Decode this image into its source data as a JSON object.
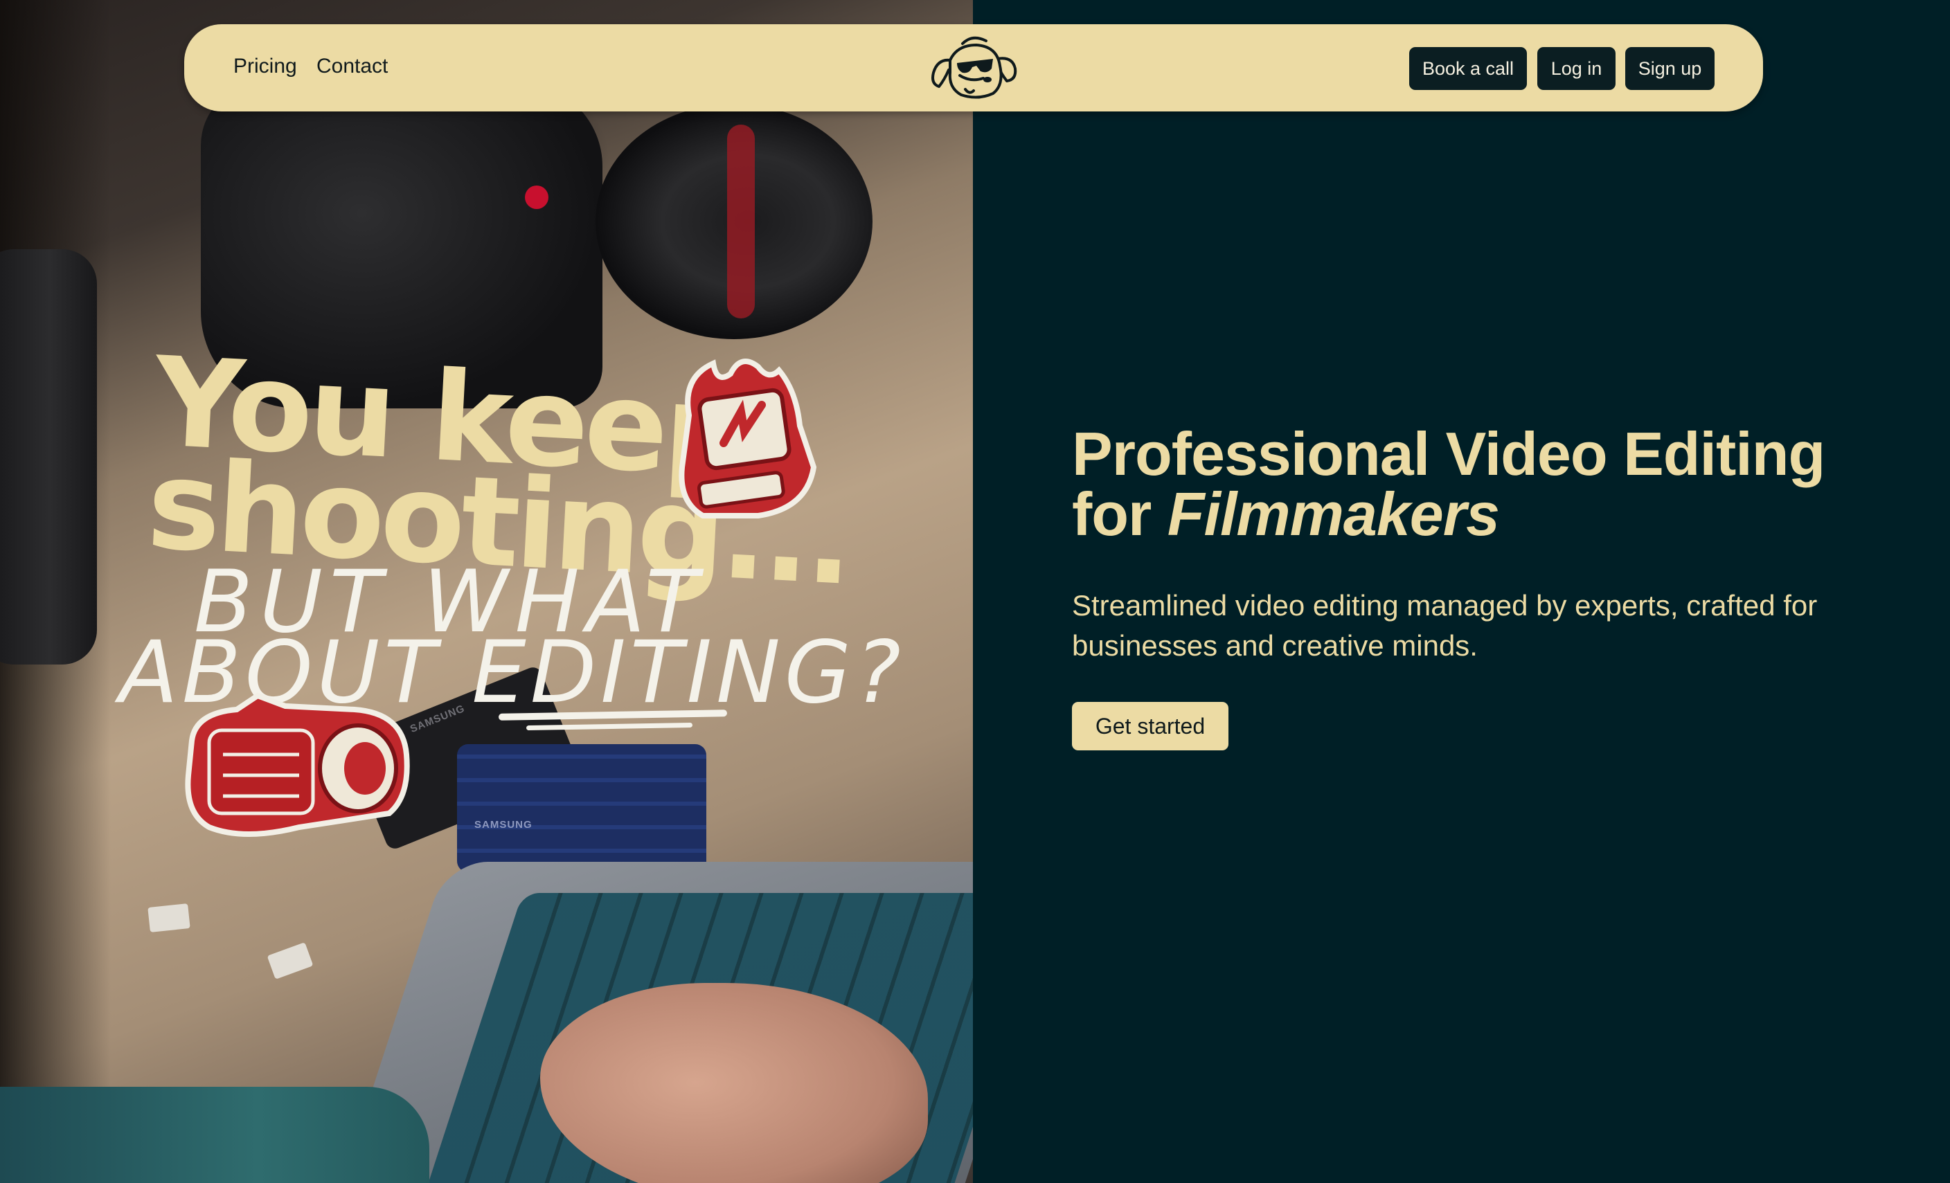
{
  "nav": {
    "links": [
      "Pricing",
      "Contact"
    ],
    "book_call": "Book a call",
    "login": "Log in",
    "signup": "Sign up",
    "logo_icon": "dog-sunglasses-logo-icon"
  },
  "photo": {
    "line1": "You keep",
    "line2": "shooting...",
    "line3": "BUT WHAT",
    "line4": "ABOUT EDITING?",
    "ssd_label_blue": "SAMSUNG",
    "ssd_label_black": "SAMSUNG",
    "stickers": [
      "flaming-computer-sticker-icon",
      "red-camera-sticker-icon"
    ]
  },
  "hero": {
    "title_line1": "Professional Video Editing",
    "title_for": "for ",
    "title_emph": "Filmmakers",
    "subtitle": "Streamlined video editing managed by experts, crafted for businesses and creative minds.",
    "cta": "Get started"
  },
  "colors": {
    "background": "#001f26",
    "accent_cream": "#ecdba4",
    "button_dark": "#0b1e22",
    "sticker_red": "#c0282c"
  }
}
